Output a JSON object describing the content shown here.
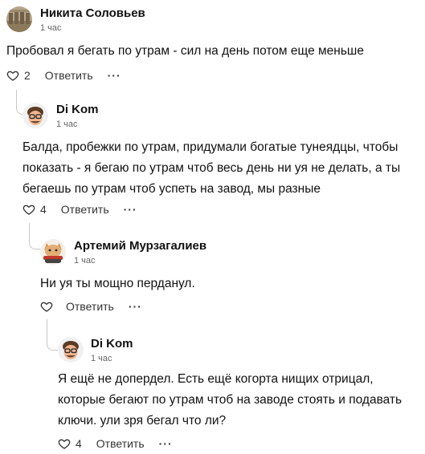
{
  "comments": [
    {
      "author": "Никита Соловьев",
      "time": "1 час",
      "text": "Пробовал я бегать по утрам - сил на день потом еще меньше",
      "likes": "2",
      "reply_label": "Ответить",
      "more_label": "···"
    },
    {
      "author": "Di Kom",
      "time": "1 час",
      "text": "Балда, пробежки по утрам, придумали богатые тунеядцы, чтобы показать - я бегаю по утрам чтоб весь день ни уя не делать, а ты бегаешь по утрам чтоб успеть на завод, мы разные",
      "likes": "4",
      "reply_label": "Ответить",
      "more_label": "···"
    },
    {
      "author": "Артемий Мурзагалиев",
      "time": "1 час",
      "text": "Ни уя ты мощно перданул.",
      "likes": "",
      "reply_label": "Ответить",
      "more_label": "···"
    },
    {
      "author": "Di Kom",
      "time": "1 час",
      "text": "Я ещё не допердел. Есть ещё когорта нищих отрицал, которые бегают по утрам чтоб на заводе стоять и подавать ключи. ули зря бегал что ли?",
      "likes": "4",
      "reply_label": "Ответить",
      "more_label": "···"
    }
  ]
}
